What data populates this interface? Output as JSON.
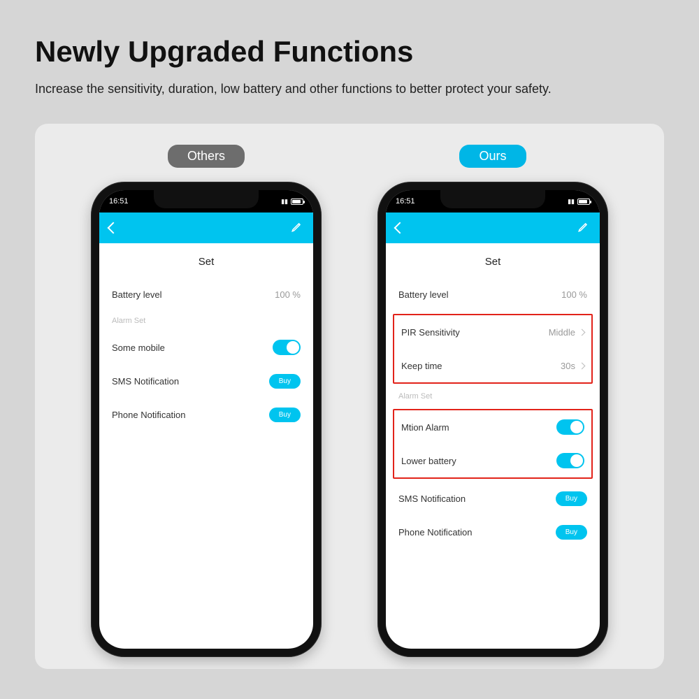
{
  "header": {
    "title": "Newly Upgraded Functions",
    "subtitle": "Increase the sensitivity, duration, low battery and other functions to better protect your safety."
  },
  "badges": {
    "others": "Others",
    "ours": "Ours"
  },
  "status": {
    "time": "16:51"
  },
  "app": {
    "section_title": "Set"
  },
  "others_phone": {
    "battery_label": "Battery level",
    "battery_value": "100 %",
    "alarm_group": "Alarm Set",
    "some_mobile": "Some mobile",
    "sms_label": "SMS Notification",
    "phone_label": "Phone Notification",
    "buy": "Buy"
  },
  "ours_phone": {
    "battery_label": "Battery level",
    "battery_value": "100 %",
    "pir_label": "PIR Sensitivity",
    "pir_value": "Middle",
    "keep_label": "Keep time",
    "keep_value": "30s",
    "alarm_group": "Alarm Set",
    "motion_label": "Mtion Alarm",
    "lowbat_label": "Lower battery",
    "sms_label": "SMS Notification",
    "phone_label": "Phone Notification",
    "buy": "Buy"
  }
}
